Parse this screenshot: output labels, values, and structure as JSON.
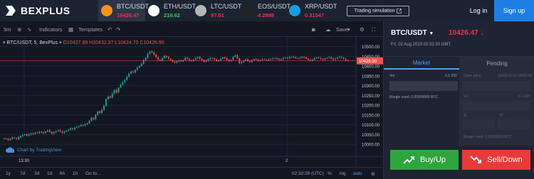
{
  "brand": {
    "name": "BEXPLUS"
  },
  "tickers": [
    {
      "symbol": "BTC/USDT",
      "price": "10426.47",
      "price_color": "#ef3340",
      "coin_color": "#f7931a",
      "icon": "bitcoin-icon",
      "active": true
    },
    {
      "symbol": "ETH/USDT",
      "price": "216.62",
      "price_color": "#3fc94f",
      "coin_color": "#ffffff",
      "icon": "ethereum-icon",
      "active": false
    },
    {
      "symbol": "LTC/USDT",
      "price": "97.51",
      "price_color": "#ef3340",
      "coin_color": "#b5b5b5",
      "icon": "litecoin-icon",
      "active": false
    },
    {
      "symbol": "EOS/USDT",
      "price": "4.2988",
      "price_color": "#ef3340",
      "coin_color": "#222222",
      "icon": "eos-icon",
      "active": false
    },
    {
      "symbol": "XRP/USDT",
      "price": "0.31547",
      "price_color": "#ef3340",
      "coin_color": "#1a9de0",
      "icon": "xrp-icon",
      "active": false
    }
  ],
  "header": {
    "sim_label": "Trading simulation",
    "login_label": "Log in",
    "signup_label": "Sign up"
  },
  "toolbar": {
    "interval": "5m",
    "indicators": "Indicators",
    "templates": "Templates",
    "save": "Save"
  },
  "chart_legend": {
    "title": "BTC/USDT, 5, BexPlus",
    "o": "O10427.99",
    "h": "H10432.37",
    "l": "L10424.70",
    "c": "C10426.90"
  },
  "chart_data": {
    "type": "candlestick",
    "ylim": [
      9975,
      10520
    ],
    "y_ticks": [
      "10500.00",
      "10450.00",
      "10400.00",
      "10350.00",
      "10300.00",
      "10250.00",
      "10200.00",
      "10150.00",
      "10100.00",
      "10050.00",
      "10000.00"
    ],
    "x_ticks": [
      "13:30",
      "2"
    ],
    "last_price": "10426.90",
    "close_series": [
      10030,
      10027,
      10022,
      10028,
      10035,
      10031,
      10026,
      10036,
      10042,
      10047,
      10051,
      10044,
      10050,
      10056,
      10053,
      10060,
      10058,
      10064,
      10061,
      10057,
      10065,
      10071,
      10063,
      10055,
      10062,
      10068,
      10072,
      10066,
      10059,
      10064,
      10070,
      10075,
      10081,
      10077,
      10085,
      10089,
      10093,
      10098,
      10096,
      10102,
      10108,
      10120,
      10135,
      10128,
      10150,
      10168,
      10160,
      10176,
      10198,
      10230,
      10245,
      10238,
      10260,
      10278,
      10265,
      10290,
      10305,
      10318,
      10330,
      10345,
      10362,
      10372,
      10368,
      10380,
      10392,
      10400,
      10412,
      10430,
      10442,
      10462,
      10475,
      10470,
      10458,
      10445,
      10432,
      10428,
      10440,
      10452,
      10446,
      10438,
      10431,
      10422,
      10418,
      10425,
      10430,
      10424,
      10430,
      10442,
      10437,
      10430,
      10426,
      10433,
      10441,
      10446,
      10438,
      10430,
      10422,
      10428,
      10436,
      10441,
      10439,
      10433,
      10426,
      10430,
      10437,
      10445,
      10440,
      10432,
      10427,
      10431,
      10448,
      10455,
      10439,
      10415,
      10420,
      10428,
      10434,
      10426,
      10422,
      10430,
      10436,
      10433,
      10428,
      10431,
      10436,
      10433,
      10430,
      10434,
      10437,
      10439,
      10441,
      10436,
      10432,
      10436,
      10441,
      10443,
      10439,
      10445,
      10448,
      10446,
      10440,
      10438,
      10442,
      10447,
      10445,
      10438,
      10432,
      10429,
      10434,
      10440,
      10444,
      10441,
      10437,
      10433,
      10438,
      10442,
      10445,
      10439,
      10434,
      10438,
      10444,
      10447,
      10443,
      10437,
      10430,
      10426
    ]
  },
  "watermark": "Chart by TradingView",
  "bottom": {
    "ranges": [
      "1y",
      "7d",
      "3d",
      "1d",
      "6h",
      "1h"
    ],
    "goto": "Go to...",
    "time": "02:32:29 (UTC)",
    "pct": "%",
    "log": "log",
    "auto": "auto"
  },
  "panel": {
    "pair": "BTC/USDT",
    "price": "10426.47 ↓",
    "date": "Fri, 02 Aug 2019 02:32:30 GMT",
    "tab_market": "Market",
    "tab_pending": "Pending",
    "vol_label": "Vol",
    "vol_range": "0.1-200",
    "margin_used": "Margin used: 0.00000000 BTC",
    "open_price_label": "Open price",
    "open_price_range": "10426.47 to 10426.47",
    "sl_label": "SL",
    "tp_label": "TP",
    "margin_used2": "Margin used: 0.00000000 BTC",
    "buy_label": "Buy/Up",
    "sell_label": "Sell/Down"
  }
}
